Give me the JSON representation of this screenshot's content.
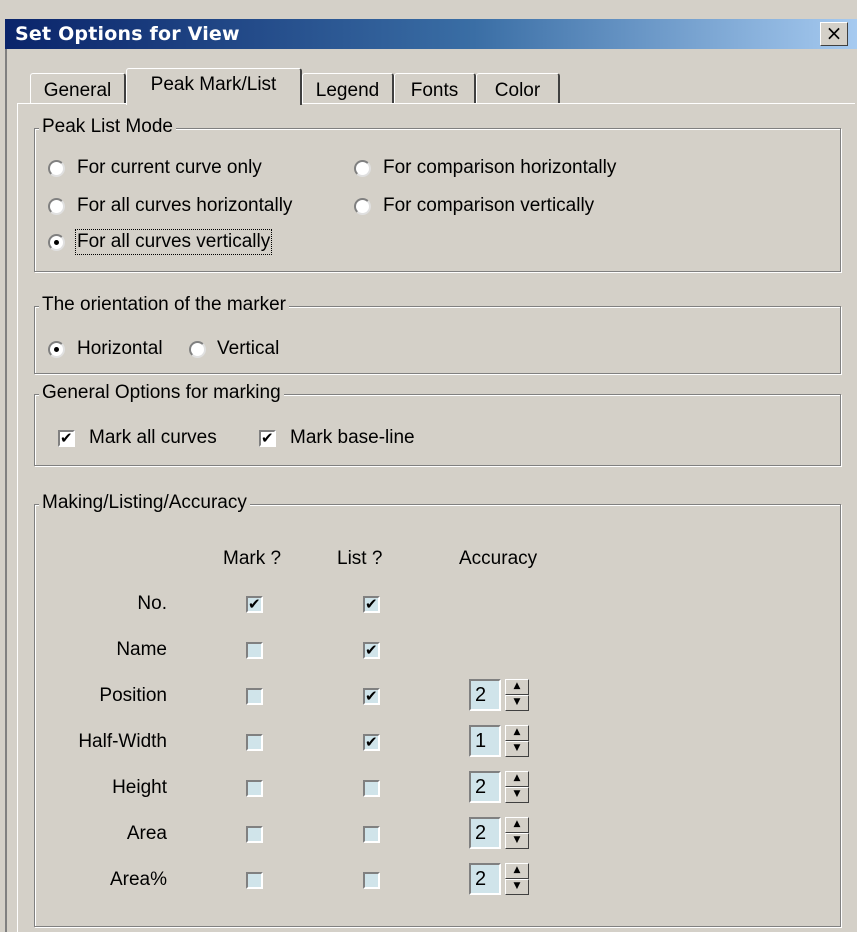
{
  "window": {
    "title": "Set Options for View",
    "close_glyph": "×"
  },
  "tabs": [
    {
      "label": "General"
    },
    {
      "label": "Peak Mark/List",
      "active": true
    },
    {
      "label": "Legend"
    },
    {
      "label": "Fonts"
    },
    {
      "label": "Color"
    }
  ],
  "peak_list_mode": {
    "legend": "Peak List Mode",
    "options": [
      {
        "label": "For current curve only",
        "checked": false
      },
      {
        "label": "For comparison horizontally",
        "checked": false
      },
      {
        "label": "For all curves horizontally",
        "checked": false
      },
      {
        "label": "For comparison vertically",
        "checked": false
      },
      {
        "label": "For all curves vertically",
        "checked": true
      }
    ]
  },
  "orientation": {
    "legend": "The orientation of the marker",
    "options": [
      {
        "label": "Horizontal",
        "checked": true
      },
      {
        "label": "Vertical",
        "checked": false
      }
    ]
  },
  "general_marking": {
    "legend": "General Options for marking",
    "options": [
      {
        "label": "Mark all curves",
        "checked": true
      },
      {
        "label": "Mark base-line",
        "checked": true
      }
    ]
  },
  "accuracy": {
    "legend": "Making/Listing/Accuracy",
    "headers": {
      "mark": "Mark ?",
      "list": "List ?",
      "accuracy": "Accuracy"
    },
    "rows": [
      {
        "label": "No.",
        "mark": true,
        "list": true,
        "accuracy": null
      },
      {
        "label": "Name",
        "mark": false,
        "list": true,
        "accuracy": null
      },
      {
        "label": "Position",
        "mark": false,
        "list": true,
        "accuracy": "2"
      },
      {
        "label": "Half-Width",
        "mark": false,
        "list": true,
        "accuracy": "1"
      },
      {
        "label": "Height",
        "mark": false,
        "list": false,
        "accuracy": "2"
      },
      {
        "label": "Area",
        "mark": false,
        "list": false,
        "accuracy": "2"
      },
      {
        "label": "Area%",
        "mark": false,
        "list": false,
        "accuracy": "2"
      }
    ]
  },
  "colors": {
    "title_gradient_start": "#0a246a",
    "title_gradient_end": "#a6caf0",
    "face": "#d4d0c8"
  }
}
